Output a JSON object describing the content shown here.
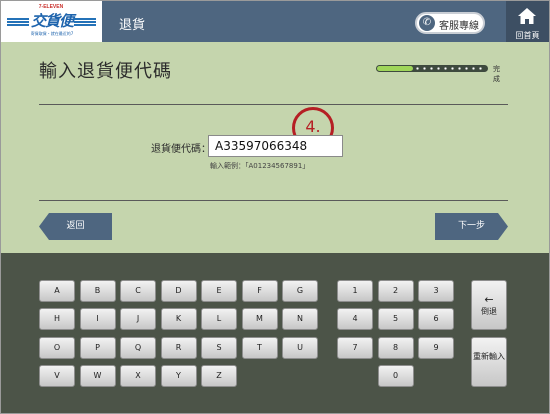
{
  "header": {
    "logo_top": "7-ELEVEN",
    "logo_main": "交貨便",
    "logo_sub": "寄貨取貨・就在最近的7",
    "title": "退貨",
    "service_label": "客服專線",
    "home_label": "回首頁"
  },
  "page": {
    "title": "輸入退貨便代碼",
    "progress_label": "完成",
    "progress_fraction": 0.33,
    "step_number": "4.",
    "code_label": "退貨便代碼：",
    "code_value": "A33597066348",
    "code_hint": "輸入範例：「A01234567891」",
    "back_label": "返回",
    "next_label": "下一步"
  },
  "keyboard": {
    "letter_rows": [
      [
        "A",
        "B",
        "C",
        "D",
        "E",
        "F",
        "G"
      ],
      [
        "H",
        "I",
        "J",
        "K",
        "L",
        "M",
        "N"
      ],
      [
        "O",
        "P",
        "Q",
        "R",
        "S",
        "T",
        "U"
      ],
      [
        "V",
        "W",
        "X",
        "Y",
        "Z"
      ]
    ],
    "digit_rows": [
      [
        "1",
        "2",
        "3"
      ],
      [
        "4",
        "5",
        "6"
      ],
      [
        "7",
        "8",
        "9"
      ],
      [
        "0"
      ]
    ],
    "backspace_label": "倒退",
    "reenter_label": "重新輸入"
  },
  "colors": {
    "header_bg": "#4e6680",
    "content_bg": "#c5d5ad",
    "keyboard_bg": "#4c5448",
    "badge_red": "#b51f24",
    "progress_green": "#9fd55a"
  }
}
